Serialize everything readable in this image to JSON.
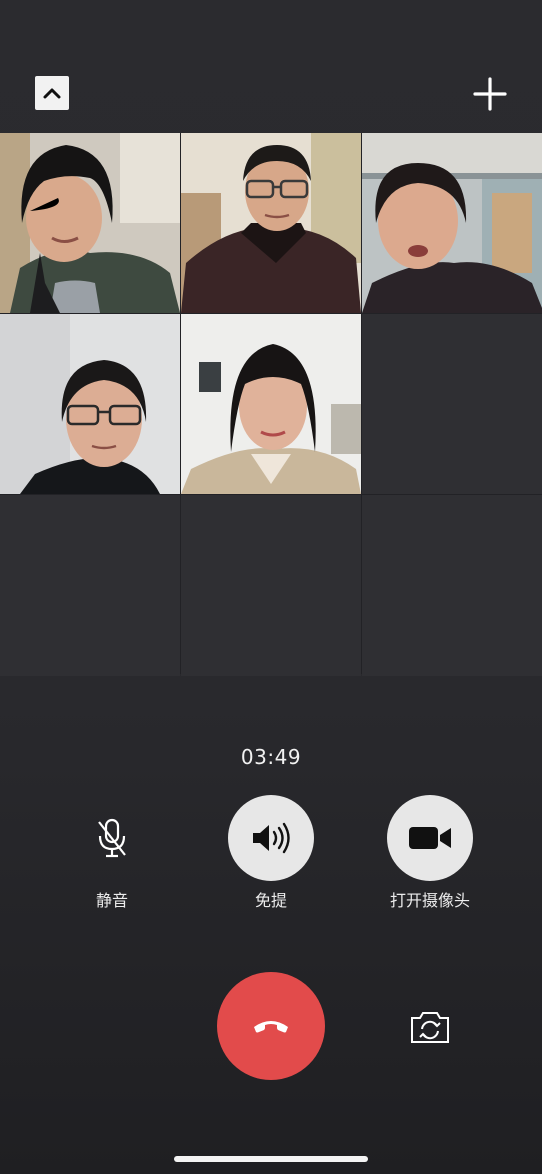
{
  "header": {
    "collapse_icon": "chevron-up-icon",
    "add_icon": "plus-icon"
  },
  "participants": [
    {
      "slot": 1,
      "video": "on"
    },
    {
      "slot": 2,
      "video": "on"
    },
    {
      "slot": 3,
      "video": "on"
    },
    {
      "slot": 4,
      "video": "on"
    },
    {
      "slot": 5,
      "video": "on"
    },
    {
      "slot": 6,
      "video": "empty"
    },
    {
      "slot": 7,
      "video": "empty"
    },
    {
      "slot": 8,
      "video": "empty"
    },
    {
      "slot": 9,
      "video": "empty"
    }
  ],
  "call": {
    "duration": "03:49"
  },
  "controls": {
    "mute": {
      "label": "静音",
      "icon": "microphone-off-icon"
    },
    "speaker": {
      "label": "免提",
      "icon": "speaker-icon"
    },
    "camera": {
      "label": "打开摄像头",
      "icon": "video-camera-icon"
    },
    "hangup": {
      "icon": "phone-hangup-icon",
      "color": "#e24b4b"
    },
    "flip_camera": {
      "icon": "camera-switch-icon"
    }
  },
  "colors": {
    "background": "#2b2b2f",
    "hangup": "#e24b4b",
    "button_light": "#e7e7e7"
  }
}
